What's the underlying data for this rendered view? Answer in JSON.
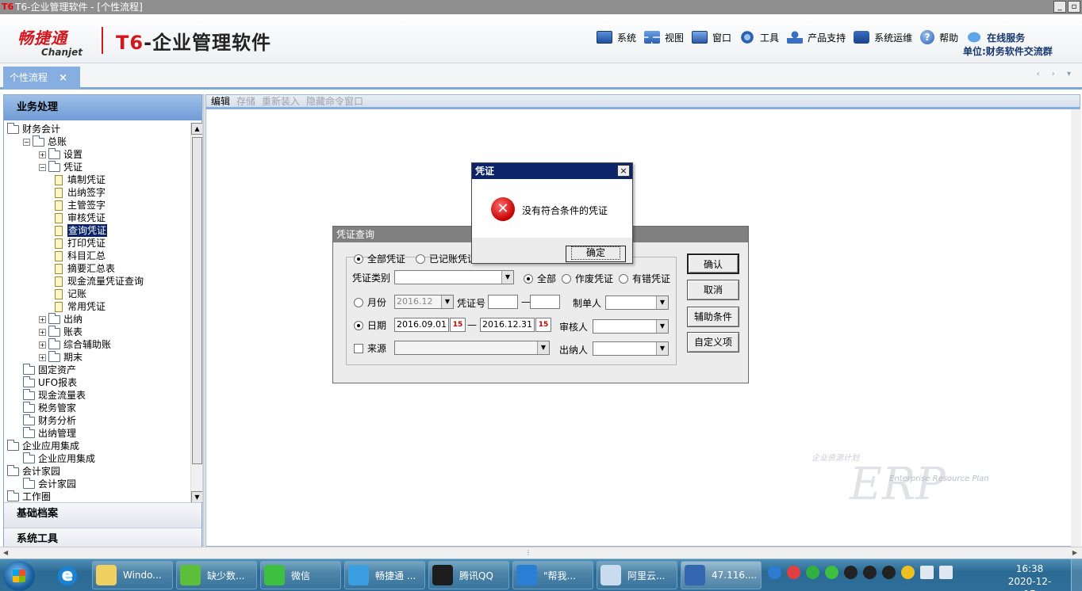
{
  "window": {
    "logo": "T6",
    "title": "T6-企业管理软件 - [个性流程]",
    "min_label": "_",
    "restore_label": "▫"
  },
  "header": {
    "brand_cn": "畅捷通",
    "brand_en": "Chanjet",
    "product_prefix": "T6",
    "product_name": "-企业管理软件",
    "menu": [
      {
        "label": "系统",
        "icon": "system-icon"
      },
      {
        "label": "视图",
        "icon": "view-icon"
      },
      {
        "label": "窗口",
        "icon": "window-icon"
      },
      {
        "label": "工具",
        "icon": "tools-icon"
      },
      {
        "label": "产品支持",
        "icon": "support-icon"
      },
      {
        "label": "系统运维",
        "icon": "ops-icon"
      },
      {
        "label": "帮助",
        "icon": "help-icon"
      },
      {
        "label": "在线服务",
        "icon": "online-service-icon"
      }
    ],
    "help_glyph": "?",
    "unit": "单位:财务软件交流群"
  },
  "tabs": {
    "active": "个性流程",
    "close_glyph": "×",
    "scroll_glyphs": "‹ › ▾"
  },
  "left_panel": {
    "header": "业务处理",
    "tree": [
      {
        "label": "财务会计",
        "level": 0,
        "type": "folder",
        "expander": ""
      },
      {
        "label": "总账",
        "level": 1,
        "type": "folder",
        "expander": "−"
      },
      {
        "label": "设置",
        "level": 2,
        "type": "folder",
        "expander": "+"
      },
      {
        "label": "凭证",
        "level": 2,
        "type": "folder",
        "expander": "−"
      },
      {
        "label": "填制凭证",
        "level": 3,
        "type": "doc"
      },
      {
        "label": "出纳签字",
        "level": 3,
        "type": "doc"
      },
      {
        "label": "主管签字",
        "level": 3,
        "type": "doc"
      },
      {
        "label": "审核凭证",
        "level": 3,
        "type": "doc"
      },
      {
        "label": "查询凭证",
        "level": 3,
        "type": "doc",
        "selected": true
      },
      {
        "label": "打印凭证",
        "level": 3,
        "type": "doc"
      },
      {
        "label": "科目汇总",
        "level": 3,
        "type": "doc"
      },
      {
        "label": "摘要汇总表",
        "level": 3,
        "type": "doc"
      },
      {
        "label": "现金流量凭证查询",
        "level": 3,
        "type": "doc"
      },
      {
        "label": "记账",
        "level": 3,
        "type": "doc"
      },
      {
        "label": "常用凭证",
        "level": 3,
        "type": "doc"
      },
      {
        "label": "出纳",
        "level": 2,
        "type": "folder",
        "expander": "+"
      },
      {
        "label": "账表",
        "level": 2,
        "type": "folder",
        "expander": "+"
      },
      {
        "label": "综合辅助账",
        "level": 2,
        "type": "folder",
        "expander": "+"
      },
      {
        "label": "期末",
        "level": 2,
        "type": "folder",
        "expander": "+"
      },
      {
        "label": "固定资产",
        "level": 1,
        "type": "folder",
        "expander": ""
      },
      {
        "label": "UFO报表",
        "level": 1,
        "type": "folder",
        "expander": ""
      },
      {
        "label": "现金流量表",
        "level": 1,
        "type": "folder",
        "expander": ""
      },
      {
        "label": "税务管家",
        "level": 1,
        "type": "folder",
        "expander": ""
      },
      {
        "label": "财务分析",
        "level": 1,
        "type": "folder",
        "expander": ""
      },
      {
        "label": "出纳管理",
        "level": 1,
        "type": "folder",
        "expander": ""
      },
      {
        "label": "企业应用集成",
        "level": 0,
        "type": "folder",
        "expander": ""
      },
      {
        "label": "企业应用集成",
        "level": 1,
        "type": "folder",
        "expander": ""
      },
      {
        "label": "会计家园",
        "level": 0,
        "type": "folder",
        "expander": ""
      },
      {
        "label": "会计家园",
        "level": 1,
        "type": "folder",
        "expander": ""
      },
      {
        "label": "工作圈",
        "level": 0,
        "type": "folder",
        "expander": ""
      }
    ],
    "scroll_up": "▲",
    "scroll_down": "▼",
    "section_basic": "基础档案",
    "section_tools": "系统工具"
  },
  "work_toolbar": {
    "edit": "编辑",
    "save": "存储",
    "reload": "重新装入",
    "hide": "隐藏命令窗口"
  },
  "watermark": {
    "cn": "企业资源计划",
    "letters": "ERP",
    "en": "Enterprise Resource Plan"
  },
  "query_dialog": {
    "title": "凭证查询",
    "radio_all": "全部凭证",
    "radio_posted": "已记账凭证",
    "type_label": "凭证类别",
    "type_value": "",
    "scope_all": "全部",
    "scope_void": "作废凭证",
    "scope_error": "有错凭证",
    "month_label": "月份",
    "month_value": "2016.12",
    "voucher_no_label": "凭证号",
    "voucher_no_from": "",
    "dash": "—",
    "voucher_no_to": "",
    "maker_label": "制单人",
    "maker_value": "",
    "date_label": "日期",
    "date_from": "2016.09.01",
    "date_to": "2016.12.31",
    "calendar_glyph": "15",
    "auditor_label": "审核人",
    "auditor_value": "",
    "source_label": "来源",
    "source_value": "",
    "cashier_label": "出纳人",
    "cashier_value": "",
    "dropdown_glyph": "▼",
    "btn_ok": "确认",
    "btn_cancel": "取消",
    "btn_aux": "辅助条件",
    "btn_custom": "自定义项"
  },
  "alert_dialog": {
    "title": "凭证",
    "close_glyph": "×",
    "error_glyph": "✕",
    "message": "没有符合条件的凭证",
    "ok": "确定"
  },
  "scrollbars": {
    "left": "◀",
    "right": "▶",
    "grip": "⋮"
  },
  "taskbar": {
    "ie_glyph": "e",
    "tasks": [
      {
        "label": "Windo...",
        "color": "#f0d060"
      },
      {
        "label": "缺少数...",
        "color": "#5cbf3a"
      },
      {
        "label": "微信",
        "color": "#3fbf3f"
      },
      {
        "label": "畅捷通 ...",
        "color": "#3a9ee0"
      },
      {
        "label": "腾讯QQ",
        "color": "#1d1d1d"
      },
      {
        "label": "\"帮我...",
        "color": "#2a7fd4"
      },
      {
        "label": "阿里云...",
        "color": "#c9dcef"
      },
      {
        "label": "47.116....",
        "color": "#3466b0"
      }
    ],
    "time": "16:38",
    "date": "2020-12-17"
  }
}
